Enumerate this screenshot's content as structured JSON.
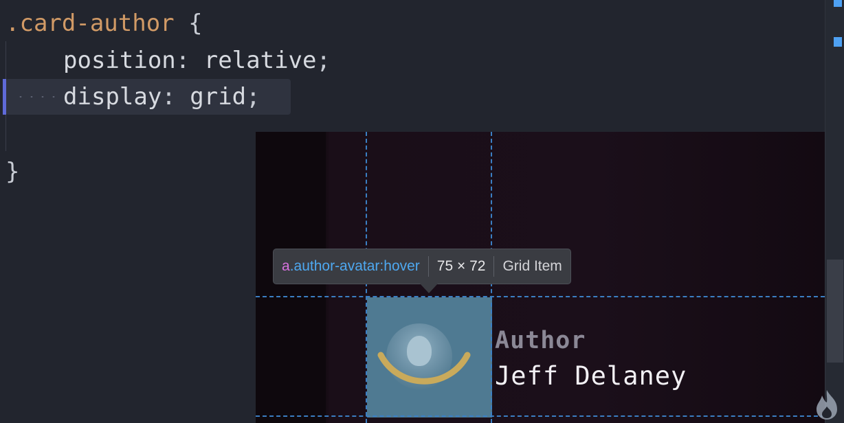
{
  "editor": {
    "lines": [
      {
        "selector": ".card-author",
        "brace_open": "{"
      },
      {
        "property": "position",
        "value": "relative"
      },
      {
        "property": "display",
        "value": "grid"
      },
      {
        "brace_close": "}"
      }
    ],
    "colon": ":",
    "semicolon": ";"
  },
  "tooltip": {
    "tag": "a",
    "selector": ".author-avatar:hover",
    "dimensions": "75 × 72",
    "item_type": "Grid Item"
  },
  "card": {
    "label": "Author",
    "name": "Jeff Delaney"
  },
  "colors": {
    "accent": "#3b7fc4",
    "highlight_overlay": "#4f7a92",
    "ring": "#c9aa5b",
    "selector_text": "#d19a66"
  },
  "icons": {
    "logo": "flame-icon"
  }
}
